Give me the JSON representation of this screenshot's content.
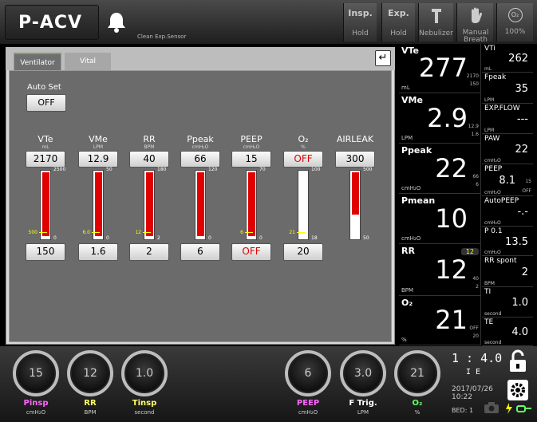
{
  "topbar": {
    "mode": "P-ACV",
    "alarm_message": "Clean  Exp.Sensor",
    "buttons": [
      {
        "id": "insp",
        "top": "Insp.",
        "bottom": "Hold"
      },
      {
        "id": "exp",
        "top": "Exp.",
        "bottom": "Hold"
      },
      {
        "id": "nebulizer",
        "top": "",
        "bottom": "Nebulizer"
      },
      {
        "id": "manual",
        "top": "",
        "bottom": "Manual Breath"
      },
      {
        "id": "o2",
        "top": "O₂",
        "bottom": "100%"
      }
    ]
  },
  "tabs": {
    "ventilator": "Ventilator",
    "vital": "Vital"
  },
  "autoset": {
    "label": "Auto  Set",
    "value": "OFF"
  },
  "columns": [
    {
      "name": "VTe",
      "unit": "mL",
      "current": "2170",
      "setting": "150",
      "max": "2500",
      "min": "0",
      "alarm": "500",
      "fill": 0.06,
      "alarm_pos": 0.2
    },
    {
      "name": "VMe",
      "unit": "LPM",
      "current": "12.9",
      "setting": "1.6",
      "max": "50",
      "min": "0",
      "alarm": "6.0",
      "fill": 0.26,
      "alarm_pos": 0.12
    },
    {
      "name": "RR",
      "unit": "BPM",
      "current": "40",
      "setting": "2",
      "max": "180",
      "min": "2",
      "alarm": "12",
      "fill": 0.22,
      "alarm_pos": 0.06
    },
    {
      "name": "Ppeak",
      "unit": "cmH₂O",
      "current": "66",
      "setting": "6",
      "max": "120",
      "min": "0",
      "alarm": "",
      "fill": 0.55,
      "alarm_pos": 0.05
    },
    {
      "name": "PEEP",
      "unit": "cmH₂O",
      "current": "15",
      "setting": "OFF",
      "max": "70",
      "min": "0",
      "alarm": "6",
      "fill": 0.21,
      "alarm_pos": 0.08
    },
    {
      "name": "O₂",
      "unit": "%",
      "current": "OFF",
      "setting": "20",
      "max": "100",
      "min": "18",
      "alarm": "21",
      "fill": 0.0,
      "alarm_pos": 0.04
    },
    {
      "name": "AIRLEAK",
      "unit": "",
      "current": "300",
      "setting": "",
      "max": "500",
      "min": "50",
      "alarm": "",
      "fill": 0.6,
      "alarm_pos": 0
    }
  ],
  "monitor_main": [
    {
      "name": "VTe",
      "value": "277",
      "unit": "mL",
      "hi": "2170",
      "lo": "150"
    },
    {
      "name": "VMe",
      "value": "2.9",
      "unit": "LPM",
      "hi": "12.9",
      "lo": "1.6"
    },
    {
      "name": "Ppeak",
      "value": "22",
      "unit": "cmH₂O",
      "hi": "66",
      "lo": "6"
    },
    {
      "name": "Pmean",
      "value": "10",
      "unit": "cmH₂O",
      "hi": "",
      "lo": ""
    },
    {
      "name": "RR",
      "value": "12",
      "unit": "BPM",
      "hi": "40",
      "lo": "2",
      "badge": "12"
    },
    {
      "name": "O₂",
      "value": "21",
      "unit": "%",
      "hi": "OFF",
      "lo": "20"
    }
  ],
  "monitor_sub": [
    {
      "name": "VTi",
      "value": "262",
      "unit": "mL"
    },
    {
      "name": "Fpeak",
      "value": "35",
      "unit": "LPM"
    },
    {
      "name": "EXP.FLOW",
      "value": "---",
      "unit": "LPM"
    },
    {
      "name": "PAW",
      "value": "22",
      "unit": "cmH₂O"
    },
    {
      "name": "PEEP",
      "value": "8.1",
      "unit": "cmH₂O",
      "hi": "15",
      "lo": "OFF"
    },
    {
      "name": "AutoPEEP",
      "value": "-.-",
      "unit": "cmH₂O"
    },
    {
      "name": "P 0.1",
      "value": "13.5",
      "unit": "cmH₂O"
    },
    {
      "name": "RR spont",
      "value": "2",
      "unit": "BPM"
    },
    {
      "name": "TI",
      "value": "1.0",
      "unit": "second"
    },
    {
      "name": "TE",
      "value": "4.0",
      "unit": "second"
    }
  ],
  "knobs": [
    {
      "name": "Pinsp",
      "value": "15",
      "unit": "cmH₂O",
      "color": "#ff66ff"
    },
    {
      "name": "RR",
      "value": "12",
      "unit": "BPM",
      "color": "#ffff66"
    },
    {
      "name": "Tinsp",
      "value": "1.0",
      "unit": "second",
      "color": "#ffff66"
    },
    {
      "name": "PEEP",
      "value": "6",
      "unit": "cmH₂O",
      "color": "#ff66ff"
    },
    {
      "name": "F Trig.",
      "value": "3.0",
      "unit": "LPM",
      "color": "#ffffff"
    },
    {
      "name": "O₂",
      "value": "21",
      "unit": "%",
      "color": "#66ff66"
    }
  ],
  "ie": {
    "ratio": "1 : 4.0",
    "label": "I E"
  },
  "status": {
    "date": "2017/07/26",
    "time": "10:22",
    "bed": "BED: 1"
  }
}
